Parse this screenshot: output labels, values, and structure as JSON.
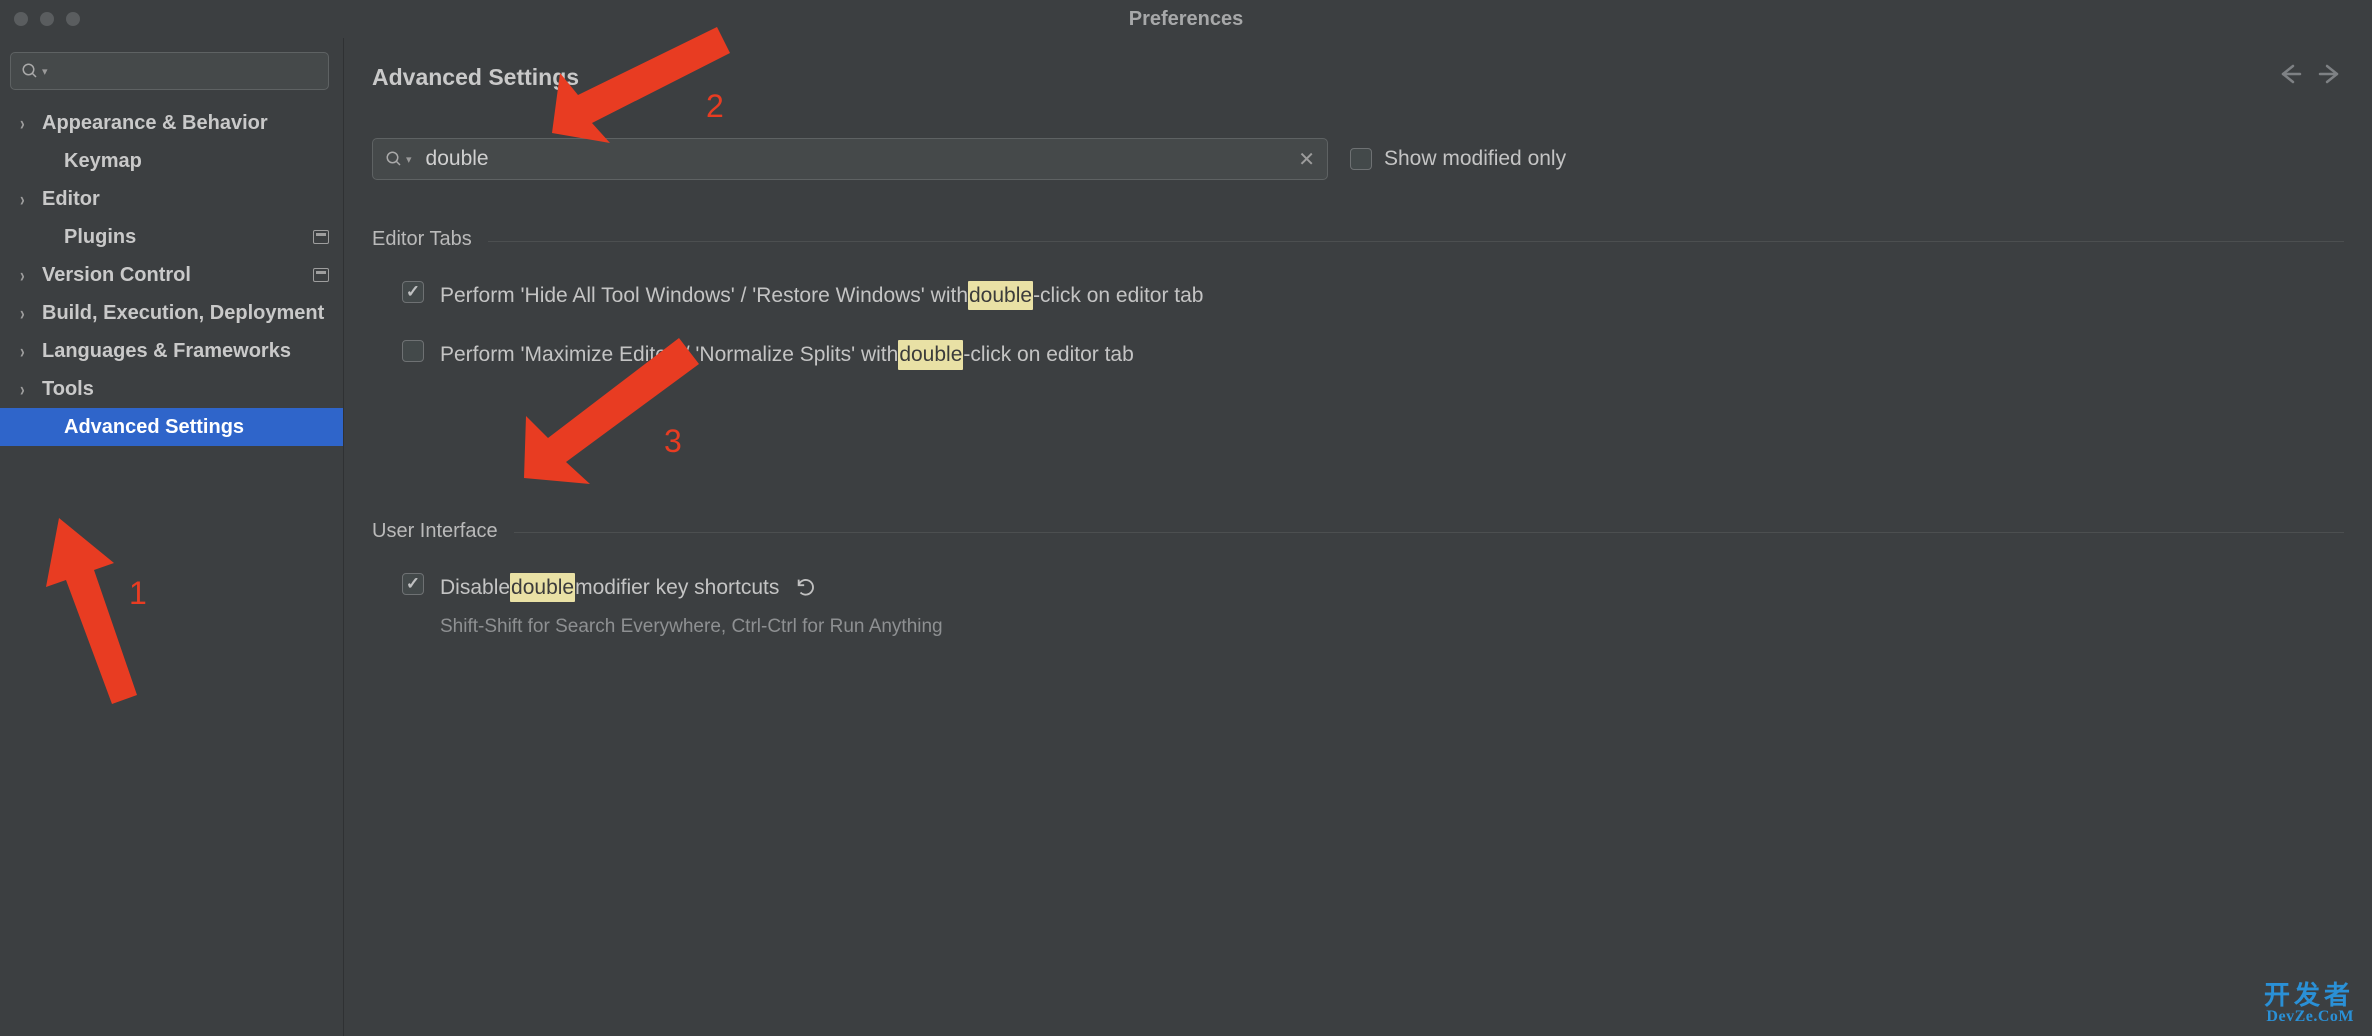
{
  "window": {
    "title": "Preferences"
  },
  "sidebar": {
    "items": [
      {
        "label": "Appearance & Behavior",
        "expandable": true,
        "badge": false
      },
      {
        "label": "Keymap",
        "expandable": false,
        "badge": false
      },
      {
        "label": "Editor",
        "expandable": true,
        "badge": false
      },
      {
        "label": "Plugins",
        "expandable": false,
        "badge": true
      },
      {
        "label": "Version Control",
        "expandable": true,
        "badge": true
      },
      {
        "label": "Build, Execution, Deployment",
        "expandable": true,
        "badge": false
      },
      {
        "label": "Languages & Frameworks",
        "expandable": true,
        "badge": false
      },
      {
        "label": "Tools",
        "expandable": true,
        "badge": false
      },
      {
        "label": "Advanced Settings",
        "expandable": false,
        "badge": false,
        "selected": true
      }
    ]
  },
  "main": {
    "heading": "Advanced Settings",
    "filter_value": "double",
    "show_modified_label": "Show modified only",
    "show_modified_checked": false,
    "sections": [
      {
        "title": "Editor Tabs",
        "options": [
          {
            "checked": true,
            "label_parts": [
              "Perform 'Hide All Tool Windows' / 'Restore Windows' with ",
              "double",
              "-click on editor tab"
            ],
            "reset": false
          },
          {
            "checked": false,
            "label_parts": [
              "Perform 'Maximize Editor' / 'Normalize Splits' with ",
              "double",
              "-click on editor tab"
            ],
            "reset": false
          }
        ]
      },
      {
        "title": "User Interface",
        "options": [
          {
            "checked": true,
            "label_parts": [
              "Disable ",
              "double",
              " modifier key shortcuts"
            ],
            "hint": "Shift-Shift for Search Everywhere, Ctrl-Ctrl for Run Anything",
            "reset": true
          }
        ]
      }
    ]
  },
  "annotations": {
    "n1": "1",
    "n2": "2",
    "n3": "3",
    "watermark_cn": "开发者",
    "watermark_en": "DevZe.CoM"
  }
}
